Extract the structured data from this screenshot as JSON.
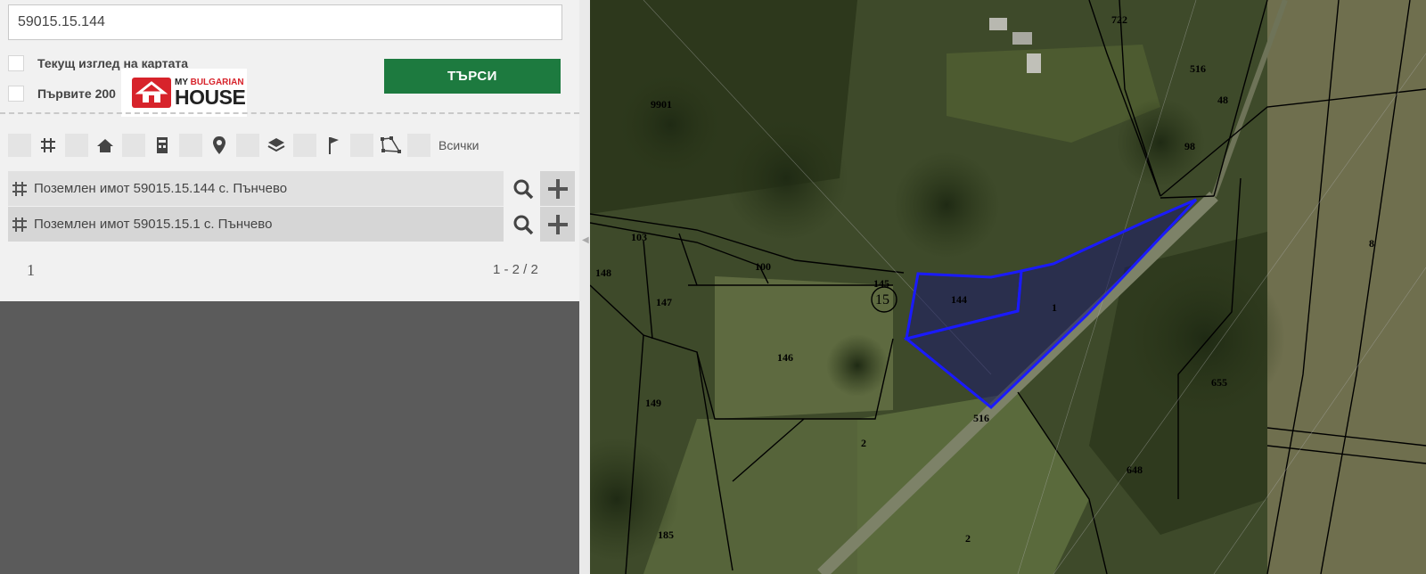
{
  "search": {
    "value": "59015.15.144"
  },
  "options": {
    "current_view_label": "Текущ изглед на картата",
    "first_label": "Първите 200"
  },
  "search_button": "ТЪРСИ",
  "logo": {
    "small_my": "MY",
    "small_bulgarian": "BULGARIAN",
    "big": "HOUSE"
  },
  "filters": {
    "icons": [
      "grid-icon",
      "home-icon",
      "building-icon",
      "location-pin-icon",
      "layers-icon",
      "flag-icon",
      "polygon-icon"
    ],
    "all_label": "Всички"
  },
  "results": [
    {
      "label": "Поземлен имот 59015.15.144 с. Пънчево"
    },
    {
      "label": "Поземлен имот 59015.15.1 с. Пънчево"
    }
  ],
  "pagination": {
    "page": "1",
    "count": "1 - 2 / 2"
  },
  "map": {
    "parcel_labels": [
      "722",
      "516",
      "9901",
      "48",
      "98",
      "103",
      "148",
      "147",
      "100",
      "145",
      "15",
      "144",
      "1",
      "146",
      "149",
      "8",
      "655",
      "516",
      "648",
      "2",
      "185",
      "2"
    ],
    "highlight_color": "#1a1aff"
  }
}
